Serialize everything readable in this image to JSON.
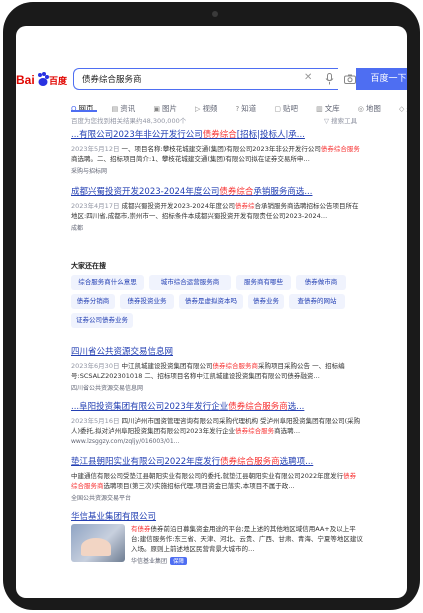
{
  "search": {
    "logo": "Bai 百度",
    "query": "债券综合服务商",
    "button": "百度一下"
  },
  "tabs": [
    {
      "icon": "search-icon",
      "label": "网页"
    },
    {
      "icon": "news-icon",
      "label": "资讯"
    },
    {
      "icon": "image-icon",
      "label": "图片"
    },
    {
      "icon": "video-icon",
      "label": "视频"
    },
    {
      "icon": "question-icon",
      "label": "知道"
    },
    {
      "icon": "forum-icon",
      "label": "贴吧"
    },
    {
      "icon": "library-icon",
      "label": "文库"
    },
    {
      "icon": "map-icon",
      "label": "地图"
    },
    {
      "icon": "purchase-icon",
      "label": "采购"
    },
    {
      "icon": "",
      "label": "更多"
    }
  ],
  "meta": {
    "count": "百度为您找到相关结果约48,300,000个",
    "tools": "搜索工具"
  },
  "results": [
    {
      "title_pre": "...有限公司2023年非公开发行公司",
      "title_em": "债券综合",
      "title_post": "[招标|投标人|承...",
      "date": "2023年5月12日",
      "snippet_pre": " 一、项目名称:攀枝花城建交通(集团)有限公司2023年非公开发行公司",
      "snippet_em": "债券综合服务",
      "snippet_post": "商选聘。二、招标项目简介:1、攀枝花城建交通(集团)有限公司拟在证券交易所申…",
      "source": "采购与招标网"
    },
    {
      "title_pre": "成都兴蜀投资开发2023-2024年度公司",
      "title_em": "债券综合",
      "title_post": "承销服务商选...",
      "date": "2023年4月17日",
      "snippet_pre": " 成都兴蜀投资开发2023-2024年度公司",
      "snippet_em": "债券综",
      "snippet_post": "合承销服务商选聘招标公告项目所在地区:四川省,成都市,崇州市一、招标条件本成都兴蜀投资开发有限责任公司2023-2024…",
      "source": "成都"
    },
    {
      "title_pre": "四川省公共资源交易信息网",
      "title_em": "",
      "title_post": "",
      "date": "2023年6月30日",
      "snippet_pre": " 中江凯城建设投资集团有限公司",
      "snippet_em": "债券综合服务商",
      "snippet_post": "采购项目采购公告 一、招标编号:SCSALZ202301018 二、招标项目名称中江凯城建设投资集团有限公司债券融资…",
      "source": "四川省公共资源交易信息网"
    },
    {
      "title_pre": "...阜阳投资集团有限公司2023年发行企业",
      "title_em": "债券综合服务商",
      "title_post": "选...",
      "date": "2023年5月16日",
      "snippet_pre": " 四川泸州市国资管理咨询有限公司采购代理机构 受泸州阜阳投资集团有限公司(采购人)委托,拟对泸州阜阳投资集团有限公司2023年发行企业",
      "snippet_em": "债券综合服务",
      "snippet_post": "商选聘…",
      "source": "www.lzsggzy.com/zqljy/016003/01..."
    },
    {
      "title_pre": "垫江县朝阳实业有限公司2022年度发行",
      "title_em": "债券综合服务商",
      "title_post": "选聘项...",
      "date": "",
      "snippet_pre": "中建通信有限公司受垫江县朝阳实业有限公司的委托,就垫江县朝阳实业有限公司2022年度发行",
      "snippet_em": "债券综合服务商",
      "snippet_post": "选聘项目(第三次)实施招标代理,项目资金已落实,本项目不属于政…",
      "source": "全国公共资源交易平台"
    },
    {
      "title_pre": "华信基业集团有限公司",
      "title_em": "",
      "title_post": "",
      "date": "",
      "snippet_pre": "",
      "snippet_em": "有债券",
      "snippet_post": "债券前沿日募集资金用途的平台;是上述的其他地区域信用AA+及以上平台;建信服务作:东三省、天津、河北、云贵、广西、甘肃、青海、宁夏等地区建议入场。原则上前述地区民营背景大城市的…",
      "source": "华信基业集团",
      "badge": "保障"
    }
  ],
  "related": {
    "title": "大家还在搜",
    "chips": [
      "综合服务商什么意思",
      "城市综合运营服务商",
      "服务商有哪些",
      "债券做市商",
      "债券分销商",
      "债券投资业务",
      "债券是虚拟资本吗",
      "债券业务",
      "查债券的网站",
      "证券公司债券业务"
    ]
  }
}
